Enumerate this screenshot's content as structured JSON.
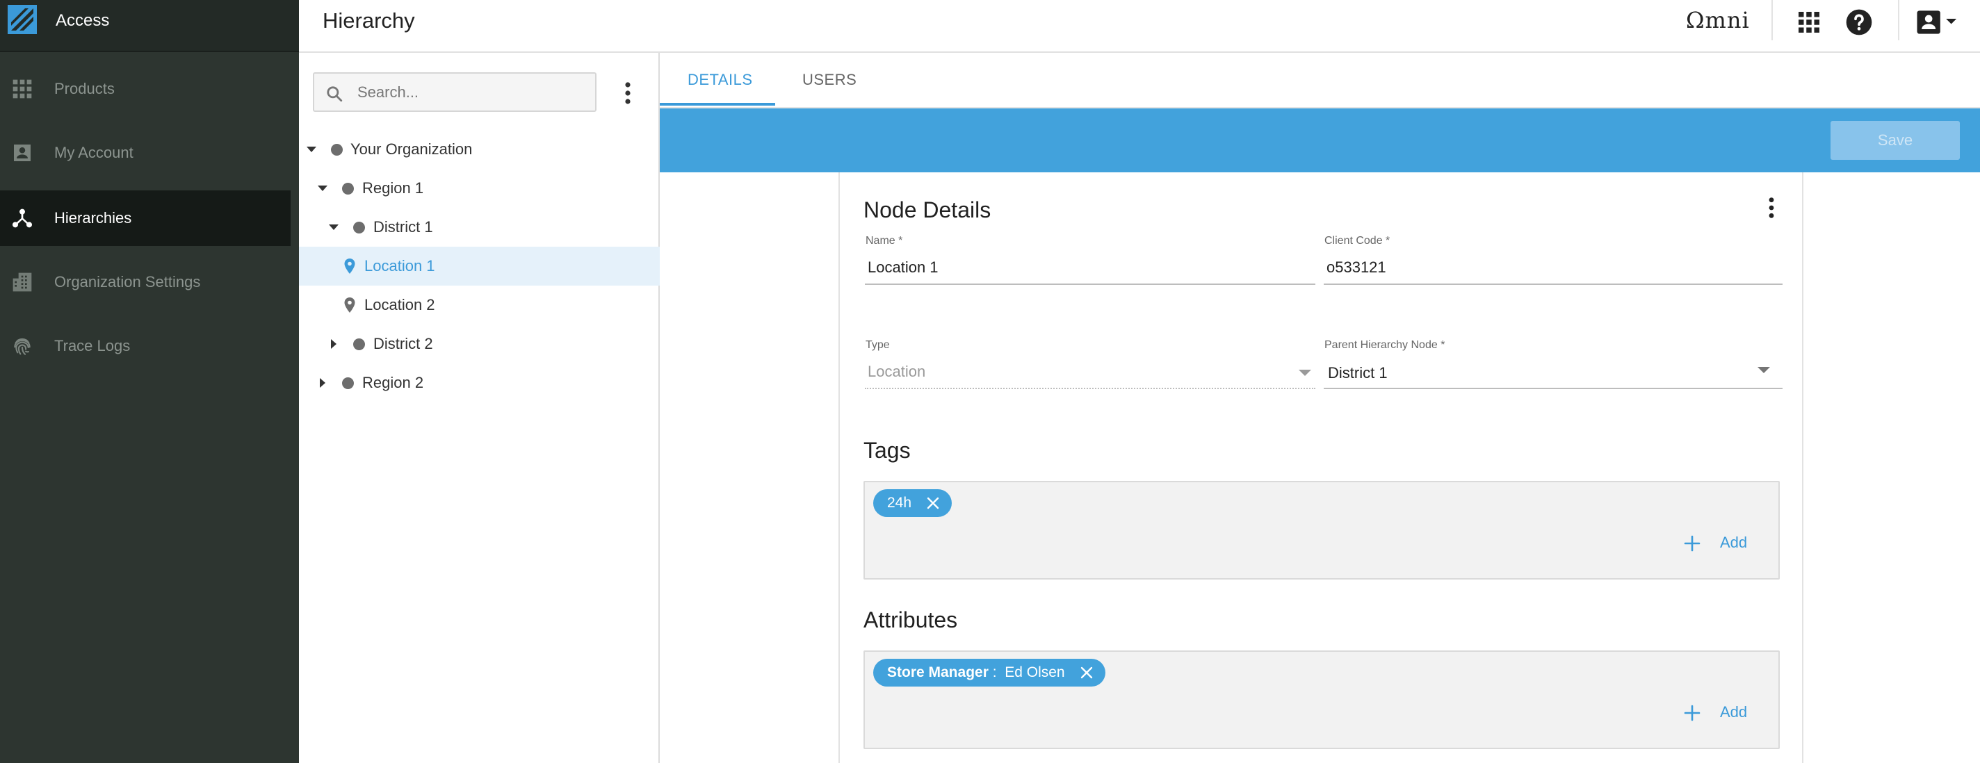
{
  "app": {
    "brand": "Access"
  },
  "sidebar": {
    "items": [
      {
        "label": "Products"
      },
      {
        "label": "My Account"
      },
      {
        "label": "Hierarchies"
      },
      {
        "label": "Organization Settings"
      },
      {
        "label": "Trace Logs"
      }
    ]
  },
  "header": {
    "title": "Hierarchy",
    "logo_text": "Ωmni"
  },
  "tree": {
    "search_placeholder": "Search...",
    "nodes": [
      {
        "label": "Your Organization"
      },
      {
        "label": "Region 1"
      },
      {
        "label": "District 1"
      },
      {
        "label": "Location 1"
      },
      {
        "label": "Location 2"
      },
      {
        "label": "District 2"
      },
      {
        "label": "Region 2"
      }
    ]
  },
  "tabs": [
    {
      "label": "DETAILS"
    },
    {
      "label": "USERS"
    }
  ],
  "toolbar": {
    "save_label": "Save"
  },
  "node_details": {
    "title": "Node Details",
    "name_label": "Name *",
    "name_value": "Location 1",
    "client_code_label": "Client Code *",
    "client_code_value": "o533121",
    "type_label": "Type",
    "type_value": "Location",
    "parent_label": "Parent Hierarchy Node *",
    "parent_value": "District 1"
  },
  "tags": {
    "title": "Tags",
    "items": [
      {
        "label": "24h"
      }
    ],
    "add_label": "Add"
  },
  "attributes": {
    "title": "Attributes",
    "items": [
      {
        "key": "Store Manager",
        "separator": ":",
        "value": "Ed Olsen"
      }
    ],
    "add_label": "Add"
  },
  "colors": {
    "accent": "#42a2dc",
    "sidebar_bg": "#2d3530",
    "sidebar_active": "#151a17"
  }
}
